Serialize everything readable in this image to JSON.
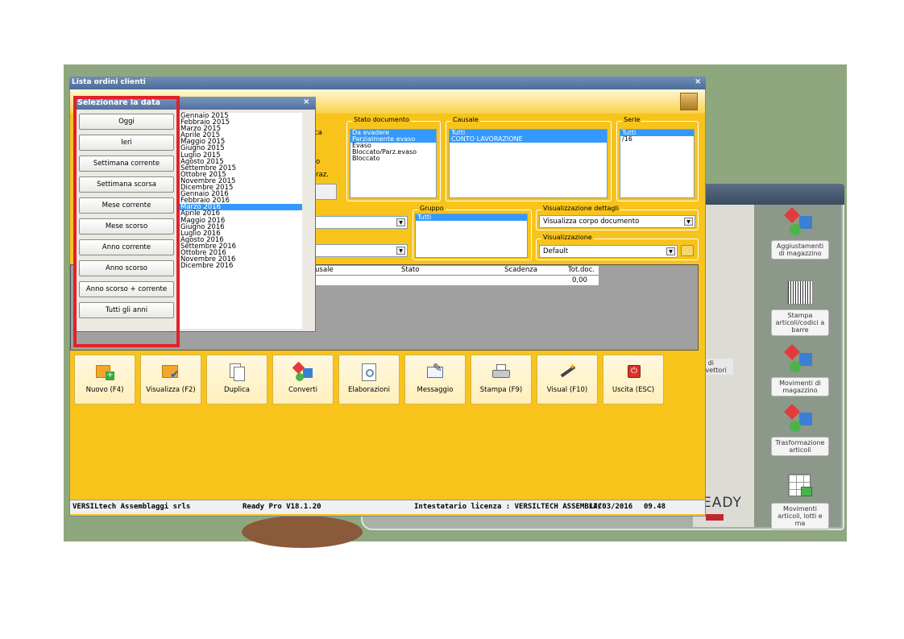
{
  "window": {
    "title": "Lista ordini clienti",
    "close": "×"
  },
  "filters": {
    "stato_documento": {
      "title": "Stato documento",
      "items": [
        "Da evadere",
        "Parzialmente evaso",
        "Evaso",
        "Bloccato/Parz.evaso",
        "Bloccato"
      ],
      "selected": [
        0,
        1
      ]
    },
    "causale": {
      "title": "Causale",
      "items": [
        "Tutti",
        "CONTO LAVORAZIONE"
      ],
      "selected": [
        0,
        1
      ]
    },
    "serie": {
      "title": "Serie",
      "items": [
        "Tutti",
        "/16"
      ],
      "selected": [
        0
      ]
    },
    "gruppo": {
      "title": "Gruppo",
      "items": [
        "Tutti"
      ],
      "selected": [
        0
      ]
    },
    "visualizzazione_dettagli": {
      "title": "Visualizzazione dettagli",
      "value": "Visualizza corpo documento"
    },
    "visualizzazione": {
      "title": "Visualizzazione",
      "value": "Default"
    },
    "partial_labels": {
      "ca": "ca",
      "o": "o",
      "raz": "raz."
    }
  },
  "grid": {
    "headers": {
      "causale": "Causale",
      "stato": "Stato",
      "scadenza": "Scadenza",
      "totdoc": "Tot.doc."
    },
    "total": "0,00"
  },
  "buttons": [
    {
      "label": "Nuovo (F4)",
      "icon": "new-doc-icon"
    },
    {
      "label": "Visualizza (F2)",
      "icon": "view-check-icon"
    },
    {
      "label": "Duplica",
      "icon": "duplicate-icon"
    },
    {
      "label": "Converti",
      "icon": "convert-icon"
    },
    {
      "label": "Elaborazioni",
      "icon": "processing-icon"
    },
    {
      "label": "Messaggio",
      "icon": "message-icon"
    },
    {
      "label": "Stampa (F9)",
      "icon": "printer-icon"
    },
    {
      "label": "Visual (F10)",
      "icon": "wand-icon"
    },
    {
      "label": "Uscita (ESC)",
      "icon": "exit-icon"
    }
  ],
  "status": {
    "company": "VERSILtech Assemblaggi srls",
    "version": "Ready Pro V18.1.20",
    "license": "Intestatario licenza : VERSILTECH ASSEMBLAC",
    "date": "17/03/2016",
    "time": "09.48"
  },
  "dialog": {
    "title": "Selezionare la data",
    "close": "×",
    "buttons": [
      "Oggi",
      "Ieri",
      "Settimana corrente",
      "Settimana scorsa",
      "Mese corrente",
      "Mese scorso",
      "Anno corrente",
      "Anno scorso",
      "Anno scorso + corrente",
      "Tutti gli anni"
    ],
    "months": [
      "Gennaio 2015",
      "Febbraio 2015",
      "Marzo 2015",
      "Aprile 2015",
      "Maggio 2015",
      "Giugno 2015",
      "Luglio 2015",
      "Agosto 2015",
      "Settembre 2015",
      "Ottobre 2015",
      "Novembre 2015",
      "Dicembre 2015",
      "Gennaio 2016",
      "Febbraio 2016",
      "Marzo 2016",
      "Aprile 2016",
      "Maggio 2016",
      "Giugno 2016",
      "Luglio 2016",
      "Agosto 2016",
      "Settembre 2016",
      "Ottobre 2016",
      "Novembre 2016",
      "Dicembre 2016"
    ],
    "selected_month": 14
  },
  "side_panel": [
    {
      "label": "Aggiustamenti di magazzino",
      "icon": "stock-adjust-icon"
    },
    {
      "label": "Stampa articoli/codici a barre",
      "icon": "barcode-icon"
    },
    {
      "label": "Movimenti di magazzino",
      "icon": "stock-move-icon"
    },
    {
      "label": "Trasformazione articoli",
      "icon": "transform-icon"
    },
    {
      "label": "Movimenti articoli, lotti e ma",
      "icon": "lots-icon"
    }
  ],
  "background": {
    "partial_text": "te di\ne vettori",
    "logo": "EADY"
  }
}
